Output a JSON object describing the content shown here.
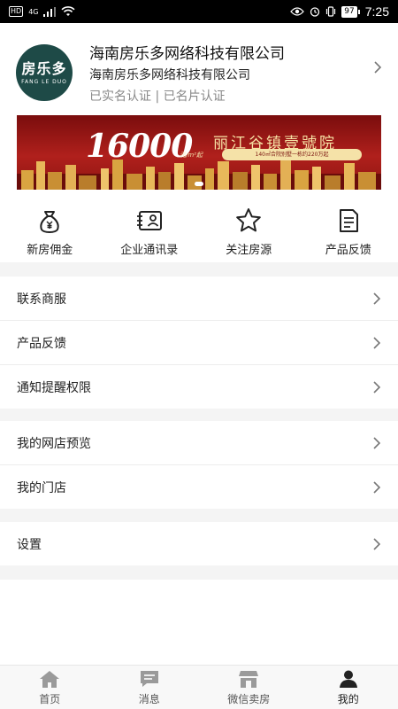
{
  "status_bar": {
    "hd": "HD",
    "network": "4G",
    "battery": "97",
    "time": "7:25"
  },
  "company": {
    "logo_cn": "房乐多",
    "logo_en": "FANG LE DUO",
    "name": "海南房乐多网络科技有限公司",
    "subname": "海南房乐多网络科技有限公司",
    "auth": "已实名认证 | 已名片认证"
  },
  "banner": {
    "number": "16000",
    "unit": "元/m²起",
    "title": "丽江谷镇壹號院",
    "subtitle": "140㎡合院别墅一栋约220万起"
  },
  "quick_actions": [
    {
      "label": "新房佣金",
      "icon": "money-bag-icon"
    },
    {
      "label": "企业通讯录",
      "icon": "contacts-card-icon"
    },
    {
      "label": "关注房源",
      "icon": "star-icon"
    },
    {
      "label": "产品反馈",
      "icon": "feedback-document-icon"
    }
  ],
  "menu": {
    "group1": [
      "联系商服",
      "产品反馈",
      "通知提醒权限"
    ],
    "group2": [
      "我的网店预览",
      "我的门店"
    ],
    "group3": [
      "设置"
    ]
  },
  "tabbar": [
    {
      "label": "首页",
      "icon": "home-icon"
    },
    {
      "label": "消息",
      "icon": "message-icon"
    },
    {
      "label": "微信卖房",
      "icon": "store-icon"
    },
    {
      "label": "我的",
      "icon": "person-icon",
      "active": true
    }
  ],
  "colors": {
    "logo_bg": "#1e4a47",
    "banner_red": "#b0201c",
    "banner_gold": "#f7e3a6",
    "tab_active": "#222222",
    "tab_inactive": "#999999",
    "separator": "#f4f4f4"
  }
}
